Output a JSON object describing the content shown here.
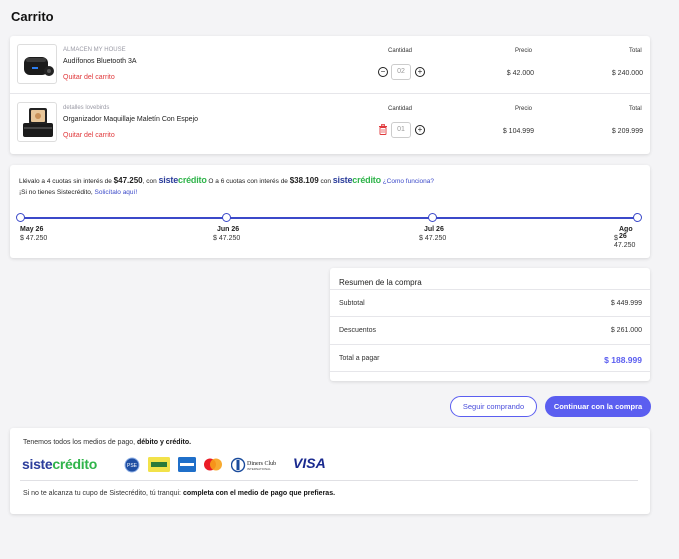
{
  "page": {
    "title": "Carrito"
  },
  "cart": {
    "headers": {
      "qty": "Cantidad",
      "price": "Precio",
      "total": "Total"
    },
    "items": [
      {
        "brand": "ALMACEN MY HOUSE",
        "name": "Audífonos Bluetooth 3A",
        "remove": "Quitar del carrito",
        "qty": "02",
        "price": "$ 42.000",
        "total": "$ 240.000"
      },
      {
        "brand": "detalles lovebirds",
        "name": "Organizador Maquillaje Maletín Con Espejo",
        "remove": "Quitar del carrito",
        "qty": "01",
        "price": "$ 104.999",
        "total": "$ 209.999"
      }
    ]
  },
  "credit": {
    "text_a": "Llévalo a 4 cuotas sin interés de ",
    "amount_4": "$47.250",
    "text_b": ", con ",
    "text_c": " O a 6 cuotas con interés de ",
    "amount_6": "$38.109",
    "text_d": " con ",
    "how_link": "¿Como funciona?",
    "brand_a": "siste",
    "brand_b": "crédito",
    "no_account": "¡Si no tienes Sistecrédito,",
    "apply_link": "Solicítalo aquí!",
    "timeline": [
      {
        "date": "May 26",
        "amount": "$ 47.250"
      },
      {
        "date": "Jun 26",
        "amount": "$ 47.250"
      },
      {
        "date": "Jul 26",
        "amount": "$ 47.250"
      },
      {
        "date": "Ago 26",
        "amount": "$ 47.250"
      }
    ]
  },
  "summary": {
    "title": "Resumen de la compra",
    "subtotal_label": "Subtotal",
    "subtotal": "$ 449.999",
    "discount_label": "Descuentos",
    "discount": "$ 261.000",
    "total_label": "Total a pagar",
    "total": "$ 188.999"
  },
  "actions": {
    "continue_shopping": "Seguir comprando",
    "checkout": "Continuar con la compra"
  },
  "payments": {
    "intro": "Tenemos todos los medios de pago, ",
    "intro_bold": "débito y crédito.",
    "brand_a": "siste",
    "brand_b": "crédito",
    "visa": "VISA",
    "diners": "Diners Club",
    "diners_sub": "INTERNATIONAL",
    "footer": "Si no te alcanza tu cupo de Sistecrédito, tú tranqui: ",
    "footer_bold": "completa con el medio de pago que prefieras."
  },
  "colors": {
    "accent": "#5b5ef0",
    "brand_blue": "#2b3d9b",
    "brand_green": "#2fb44a",
    "danger": "#e0383b"
  }
}
